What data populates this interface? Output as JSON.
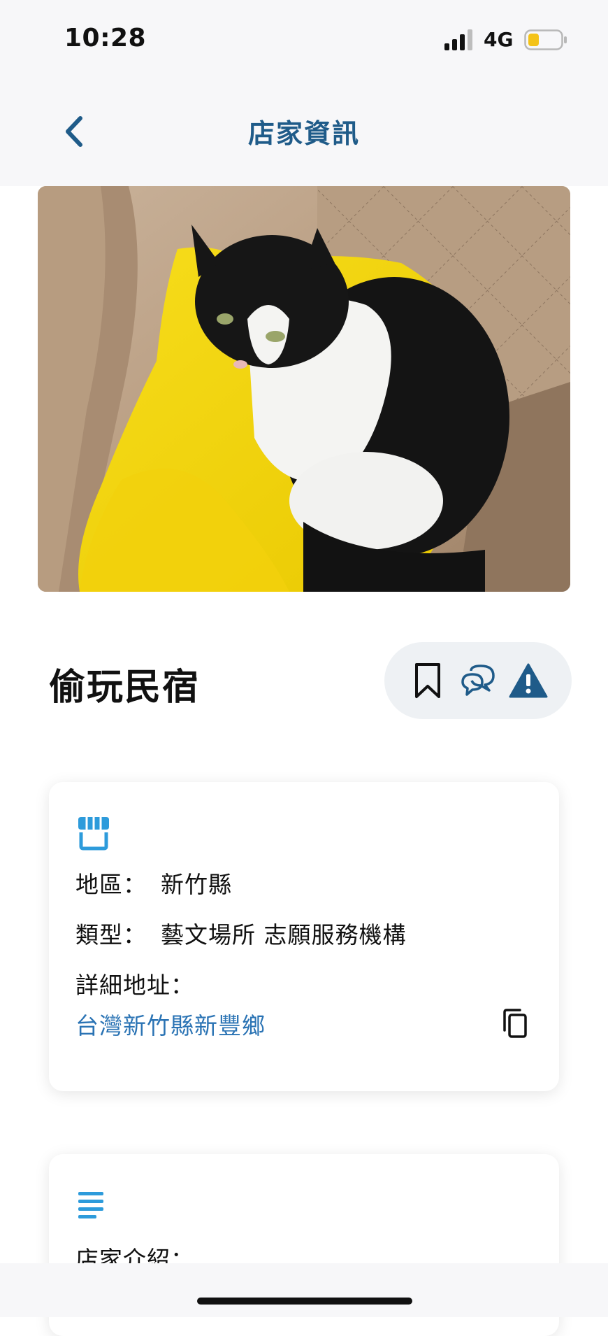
{
  "status_bar": {
    "time": "10:28",
    "network": "4G",
    "battery_level": 0.3,
    "battery_color": "#f4c318"
  },
  "nav": {
    "title": "店家資訊",
    "back_icon": "chevron-left-icon"
  },
  "shop": {
    "name": "偷玩民宿",
    "actions": [
      {
        "icon": "bookmark-icon"
      },
      {
        "icon": "chat-bubbles-icon"
      },
      {
        "icon": "warning-icon"
      }
    ]
  },
  "info_card": {
    "icon": "storefront-icon",
    "region_label": "地區：",
    "region_value": "新竹縣",
    "type_label": "類型：",
    "type_value": "藝文場所 志願服務機構",
    "address_label": "詳細地址：",
    "address_value": "台灣新竹縣新豐鄉",
    "copy_icon": "copy-icon"
  },
  "intro_card": {
    "icon": "list-lines-icon",
    "label": "店家介紹："
  },
  "colors": {
    "accent": "#1f5b89",
    "link": "#2a73b4",
    "icon_blue": "#2d9bdb"
  }
}
